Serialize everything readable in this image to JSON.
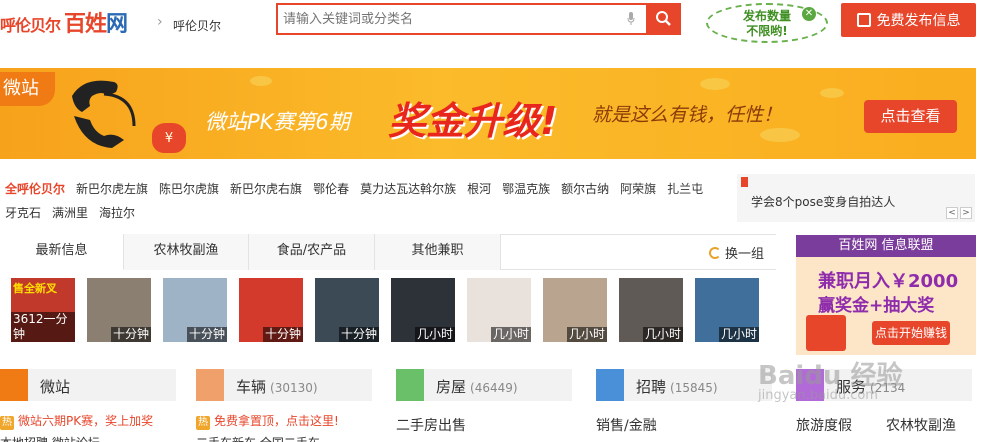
{
  "header": {
    "logo_city": "呼伦贝尔",
    "logo_brand_1": "百姓",
    "logo_brand_2": "网",
    "breadcrumb_sep": "›",
    "breadcrumb_city": "呼伦贝尔",
    "search_placeholder": "请输入关键词或分类名",
    "ad_badge_line1": "发布数量",
    "ad_badge_line2": "不限哟!",
    "post_button": "免费发布信息"
  },
  "banner": {
    "tag": "微站",
    "bag_symbol": "¥",
    "text1": "微站PK赛第6期",
    "text2": "奖金升级!",
    "text3": "就是这么有钱，任性！",
    "cta": "点击查看"
  },
  "cities": {
    "current": "全呼伦贝尔",
    "items": [
      "新巴尔虎左旗",
      "陈巴尔虎旗",
      "新巴尔虎右旗",
      "鄂伦春",
      "莫力达瓦达斡尔族",
      "根河",
      "鄂温克族",
      "额尔古纳",
      "阿荣旗",
      "扎兰屯",
      "牙克石",
      "满洲里",
      "海拉尔"
    ]
  },
  "ticker": {
    "text": "学会8个pose变身自拍达人",
    "prev": "<",
    "next": ">"
  },
  "tabs": {
    "items": [
      "最新信息",
      "农林牧副渔",
      "食品/农产品",
      "其他兼职"
    ],
    "refresh": "换一组"
  },
  "thumbnails": [
    {
      "label": "3612一分钟",
      "overlay": "售全新叉",
      "bg": "#c0392b"
    },
    {
      "label": "十分钟",
      "overlay": "",
      "bg": "#8a7f70"
    },
    {
      "label": "十分钟",
      "overlay": "",
      "bg": "#9fb3c6"
    },
    {
      "label": "十分钟",
      "overlay": "",
      "bg": "#d43a2c"
    },
    {
      "label": "十分钟",
      "overlay": "",
      "bg": "#3b4a54"
    },
    {
      "label": "几小时",
      "overlay": "",
      "bg": "#2d3238"
    },
    {
      "label": "几小时",
      "overlay": "",
      "bg": "#e9e2dc"
    },
    {
      "label": "几小时",
      "overlay": "",
      "bg": "#b9a48f"
    },
    {
      "label": "几小时",
      "overlay": "",
      "bg": "#5f5a55"
    },
    {
      "label": "几小时",
      "overlay": "",
      "bg": "#3f6f9a"
    }
  ],
  "side_ad": {
    "header": "百姓网 信息联盟",
    "line1": "兼职月入￥2000",
    "line2": "赢奖金+抽大奖",
    "button": "点击开始赚钱"
  },
  "categories": [
    {
      "name": "微站",
      "count": "",
      "color": "#f07a14"
    },
    {
      "name": "车辆",
      "count": "(30130)",
      "color": "#f0a06a"
    },
    {
      "name": "房屋",
      "count": "(46449)",
      "color": "#6abf69"
    },
    {
      "name": "招聘",
      "count": "(15845)",
      "color": "#4a90d9"
    },
    {
      "name": "服务",
      "count": "(2134",
      "color": "#b26ad8"
    }
  ],
  "cat_lines": {
    "weizhan_hot": "微站六期PK赛，奖上加奖",
    "car_hot": "免费拿置顶，点击这里!",
    "house_sub": "二手房出售",
    "job_sub": "销售/金融",
    "service_sub1": "旅游度假",
    "service_sub2": "农林牧副渔",
    "hot_badge": "热",
    "partial1": "本地招聘  微站论坛",
    "partial2": "二手车新车   全国二手车"
  },
  "watermark": {
    "main": "Baidu 经验",
    "sub": "jingyan.baidu.com"
  }
}
